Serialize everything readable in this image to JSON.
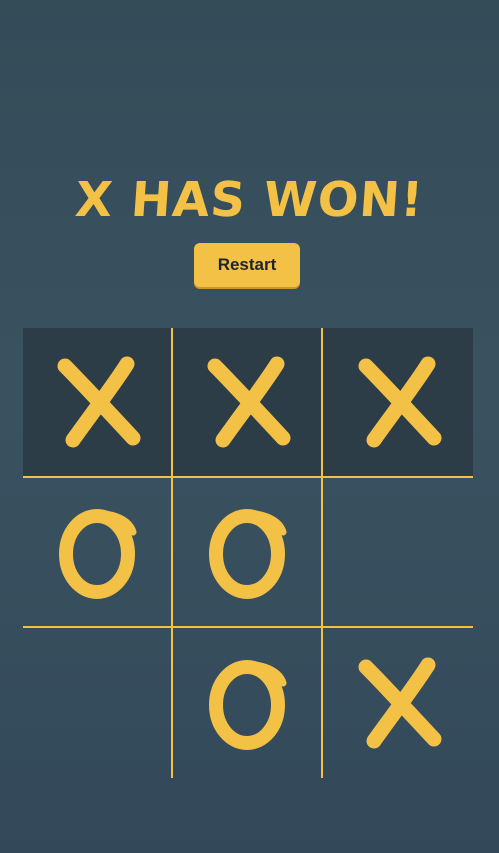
{
  "status": {
    "message": "X HAS WON!"
  },
  "controls": {
    "restart_label": "Restart"
  },
  "board": {
    "cells": [
      {
        "mark": "X",
        "winning": true
      },
      {
        "mark": "X",
        "winning": true
      },
      {
        "mark": "X",
        "winning": true
      },
      {
        "mark": "O",
        "winning": false
      },
      {
        "mark": "O",
        "winning": false
      },
      {
        "mark": "",
        "winning": false
      },
      {
        "mark": "",
        "winning": false
      },
      {
        "mark": "O",
        "winning": false
      },
      {
        "mark": "X",
        "winning": false
      }
    ]
  },
  "colors": {
    "accent": "#f2c146",
    "background": "#374e5b",
    "winning_cell": "#2c3d48"
  },
  "icons": {
    "x": "x-mark-icon",
    "o": "o-mark-icon"
  }
}
